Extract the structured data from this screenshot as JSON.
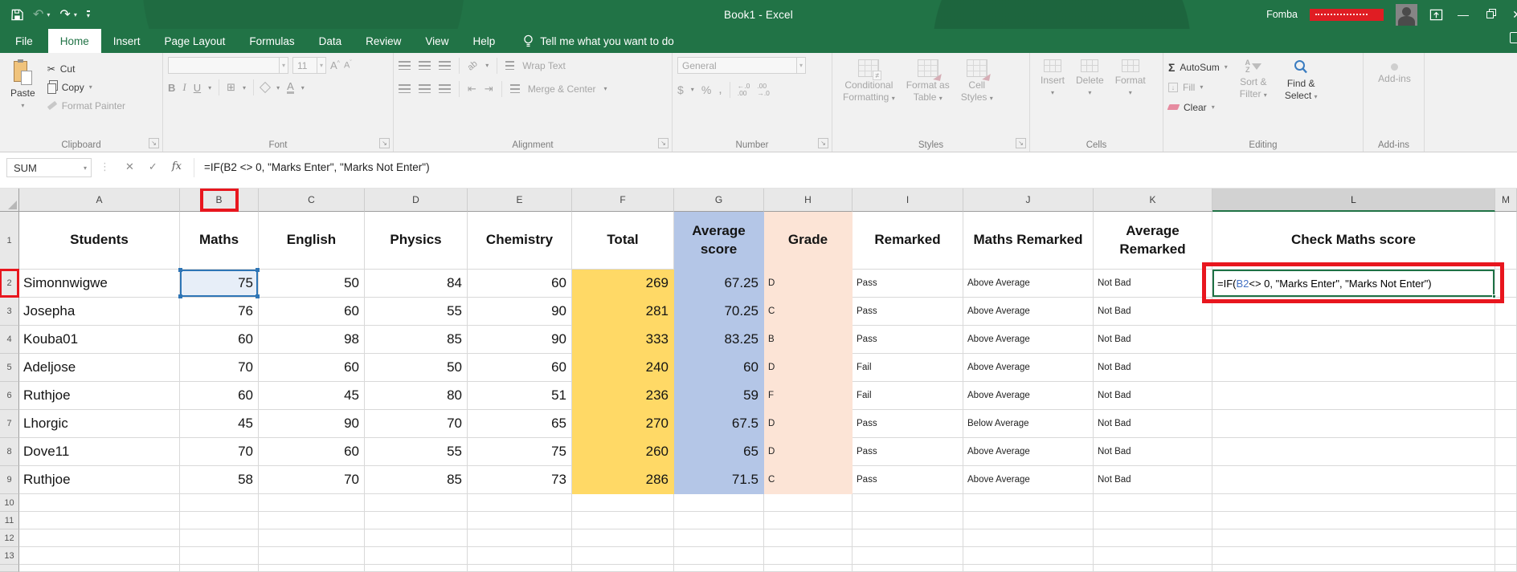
{
  "titlebar": {
    "title": "Book1 - Excel",
    "user": "Fomba"
  },
  "tabs": {
    "items": [
      "File",
      "Home",
      "Insert",
      "Page Layout",
      "Formulas",
      "Data",
      "Review",
      "View",
      "Help"
    ],
    "active": "Home",
    "tell_me": "Tell me what you want to do"
  },
  "ribbon": {
    "clipboard": {
      "label": "Clipboard",
      "paste": "Paste",
      "cut": "Cut",
      "copy": "Copy",
      "format_painter": "Format Painter"
    },
    "font": {
      "label": "Font",
      "size": "11",
      "bold": "B",
      "italic": "I",
      "underline": "U",
      "grow": "A",
      "shrink": "A",
      "color": "A",
      "border": "⊞"
    },
    "alignment": {
      "label": "Alignment",
      "wrap_text": "Wrap Text",
      "merge_center": "Merge & Center",
      "orient": "ab"
    },
    "number": {
      "label": "Number",
      "format": "General",
      "currency": "$",
      "percent": "%",
      "comma": ",",
      "inc_dec_top": "←.0",
      "inc_dec_bot": ".00",
      "dec_dec_top": ".00",
      "dec_dec_bot": "→.0"
    },
    "styles": {
      "label": "Styles",
      "conditional_line1": "Conditional",
      "conditional_line2": "Formatting",
      "format_table_line1": "Format as",
      "format_table_line2": "Table",
      "cell_styles_line1": "Cell",
      "cell_styles_line2": "Styles"
    },
    "cells": {
      "label": "Cells",
      "insert": "Insert",
      "delete": "Delete",
      "format": "Format"
    },
    "editing": {
      "label": "Editing",
      "autosum": "AutoSum",
      "fill": "Fill",
      "clear": "Clear",
      "sort_line1": "Sort &",
      "sort_line2": "Filter",
      "find_line1": "Find &",
      "find_line2": "Select",
      "sort_icon_a": "A",
      "sort_icon_z": "Z"
    },
    "addins": {
      "label": "Add-ins",
      "button": "Add-ins"
    }
  },
  "formula_bar": {
    "name_box": "SUM",
    "formula": "=IF(B2 <> 0, \"Marks Enter\", \"Marks Not Enter\")"
  },
  "sheet": {
    "col_headers": [
      "A",
      "B",
      "C",
      "D",
      "E",
      "F",
      "G",
      "H",
      "I",
      "J",
      "K",
      "L",
      "M"
    ],
    "selected_col": "L",
    "annotated_col": "B",
    "annotated_row": "2",
    "header_row": [
      "Students",
      "Maths",
      "English",
      "Physics",
      "Chemistry",
      "Total",
      "Average score",
      "Grade",
      "Remarked",
      "Maths Remarked",
      "Average Remarked",
      "Check Maths score",
      ""
    ],
    "rows": [
      [
        "Simonnwigwe",
        "75",
        "50",
        "84",
        "60",
        "269",
        "67.25",
        "D",
        "Pass",
        "Above Average",
        "Not Bad"
      ],
      [
        "Josepha",
        "76",
        "60",
        "55",
        "90",
        "281",
        "70.25",
        "C",
        "Pass",
        "Above Average",
        "Not Bad"
      ],
      [
        "Kouba01",
        "60",
        "98",
        "85",
        "90",
        "333",
        "83.25",
        "B",
        "Pass",
        "Above Average",
        "Not Bad"
      ],
      [
        "Adeljose",
        "70",
        "60",
        "50",
        "60",
        "240",
        "60",
        "D",
        "Fail",
        "Above Average",
        "Not Bad"
      ],
      [
        "Ruthjoe",
        "60",
        "45",
        "80",
        "51",
        "236",
        "59",
        "F",
        "Fail",
        "Above Average",
        "Not Bad"
      ],
      [
        "Lhorgic",
        "45",
        "90",
        "70",
        "65",
        "270",
        "67.5",
        "D",
        "Pass",
        "Below Average",
        "Not Bad"
      ],
      [
        "Dove11",
        "70",
        "60",
        "55",
        "75",
        "260",
        "65",
        "D",
        "Pass",
        "Above Average",
        "Not Bad"
      ],
      [
        "Ruthjoe",
        "58",
        "70",
        "85",
        "73",
        "286",
        "71.5",
        "C",
        "Pass",
        "Above Average",
        "Not Bad"
      ]
    ],
    "empty_rows": [
      "10",
      "11",
      "12",
      "13"
    ],
    "edit_cell": {
      "address": "L2",
      "formula_prefix": "=IF(",
      "formula_ref": "B2",
      "formula_suffix": " <> 0, \"Marks Enter\", \"Marks Not Enter\")"
    }
  },
  "icons": {
    "caret": "▾",
    "ellipsis": "⋮",
    "cancel": "✕",
    "confirm": "✓",
    "function": "fx",
    "cut": "✂",
    "undo": "↶",
    "redo": "↷",
    "sigma": "Σ",
    "launcher": "↘",
    "fill_arrow": "↓",
    "minimize": "—",
    "close": "✕",
    "indent_left": "⇤",
    "indent_right": "⇥"
  },
  "colors": {
    "excel_green": "#217346",
    "total_fill": "#ffd966",
    "average_fill": "#b4c6e7",
    "grade_fill": "#fce4d6",
    "selection_blue": "#2e75b6",
    "edit_border_green": "#1e7145",
    "annotation_red": "#e8161e"
  }
}
